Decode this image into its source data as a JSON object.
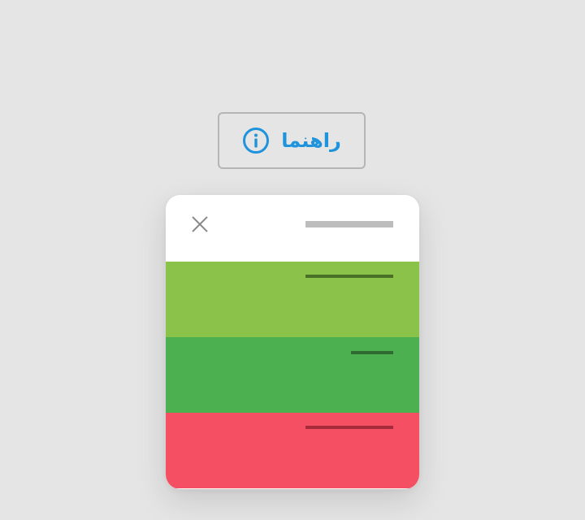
{
  "help_button": {
    "label": "راهنما",
    "icon": "info-icon",
    "color": "#1f93dc",
    "border_color": "#b5b5b5"
  },
  "dialog": {
    "background": "#ffffff",
    "close_icon": "close-icon",
    "header_placeholder_color": "#bdbdbd",
    "rows": [
      {
        "color": "#8bc34a",
        "line_color": "#4a7028"
      },
      {
        "color": "#4caf50",
        "line_color": "#2f6a31"
      },
      {
        "color": "#f44f63",
        "line_color": "#a52a3a"
      }
    ]
  }
}
